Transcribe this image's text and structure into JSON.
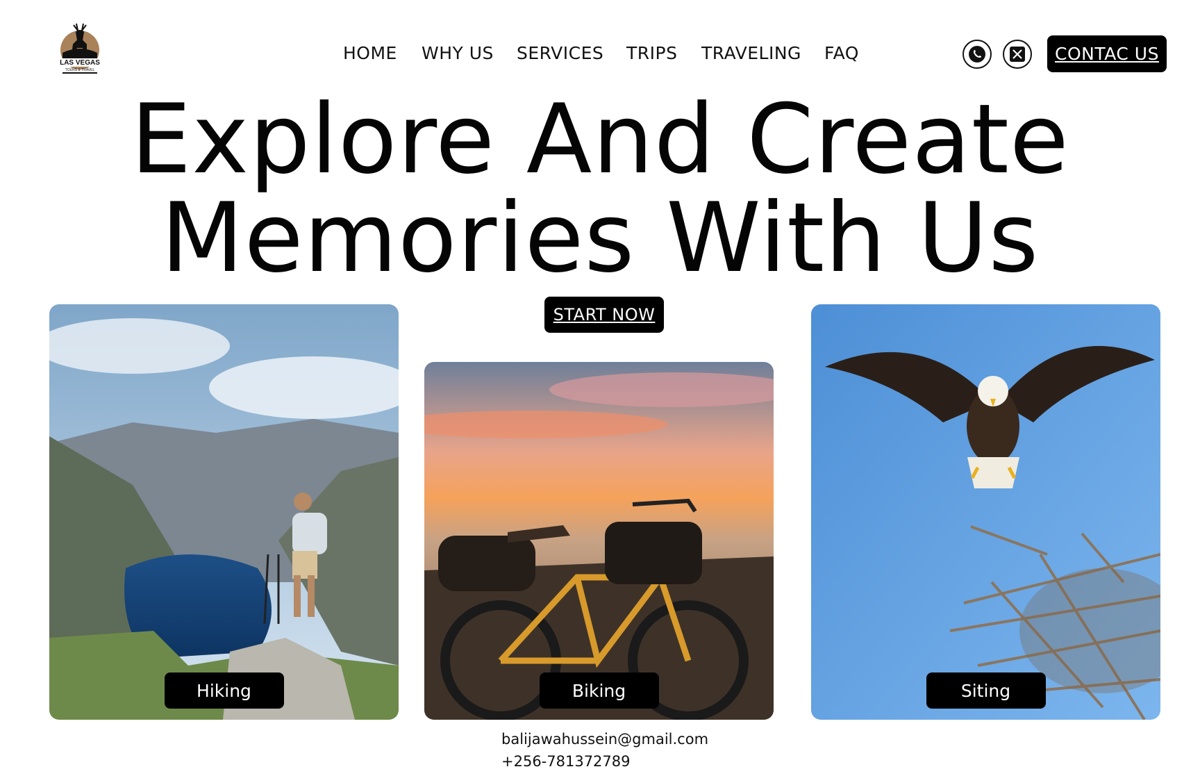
{
  "brand": {
    "logo_text": "LAS VEGAS",
    "logo_subtext": "TOURS & TRAVEL"
  },
  "nav": {
    "items": [
      {
        "label": "HOME"
      },
      {
        "label": "WHY US"
      },
      {
        "label": "SERVICES"
      },
      {
        "label": "TRIPS"
      },
      {
        "label": "TRAVELING"
      },
      {
        "label": "FAQ"
      }
    ],
    "social": [
      "whatsapp-icon",
      "x-icon"
    ],
    "contact_label": "CONTAC US"
  },
  "hero": {
    "line1": "Explore And Create",
    "line2": "Memories With Us",
    "cta_label": "START NOW"
  },
  "cards": [
    {
      "label": "Hiking"
    },
    {
      "label": "Biking"
    },
    {
      "label": "Siting"
    }
  ],
  "footer": {
    "email": "balijawahussein@gmail.com",
    "phone": "+256-781372789"
  }
}
